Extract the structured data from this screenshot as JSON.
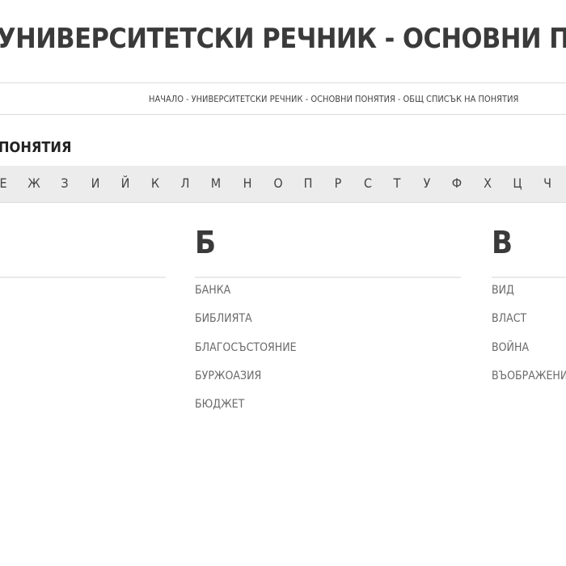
{
  "site": {
    "title": "УНИВЕРСИТЕТСКИ РЕЧНИК - ОСНОВНИ ПОНЯТИЯ"
  },
  "breadcrumb": {
    "items": [
      "НАЧАЛО",
      "УНИВЕРСИТЕТСКИ РЕЧНИК - ОСНОВНИ ПОНЯТИЯ",
      "ОБЩ СПИСЪК НА ПОНЯТИЯ"
    ],
    "separator": "-"
  },
  "section": {
    "title": "ПОНЯТИЯ"
  },
  "alphabet": [
    "Е",
    "Ж",
    "З",
    "И",
    "Й",
    "К",
    "Л",
    "М",
    "Н",
    "О",
    "П",
    "Р",
    "С",
    "Т",
    "У",
    "Ф",
    "Х",
    "Ц",
    "Ч"
  ],
  "columns": {
    "b": {
      "letter": "Б",
      "terms": [
        "БАНКА",
        "БИБЛИЯТА",
        "БЛАГОСЪСТОЯНИЕ",
        "БУРЖОАЗИЯ",
        "БЮДЖЕТ"
      ]
    },
    "v": {
      "letter": "В",
      "terms": [
        "ВИД",
        "ВЛАСТ",
        "ВОЙНА",
        "ВЪОБРАЖЕНИЕ"
      ]
    }
  },
  "colors": {
    "title": "#3a3a3a",
    "alphabet_bar": "#ececec",
    "term": "#6a6a6a"
  }
}
